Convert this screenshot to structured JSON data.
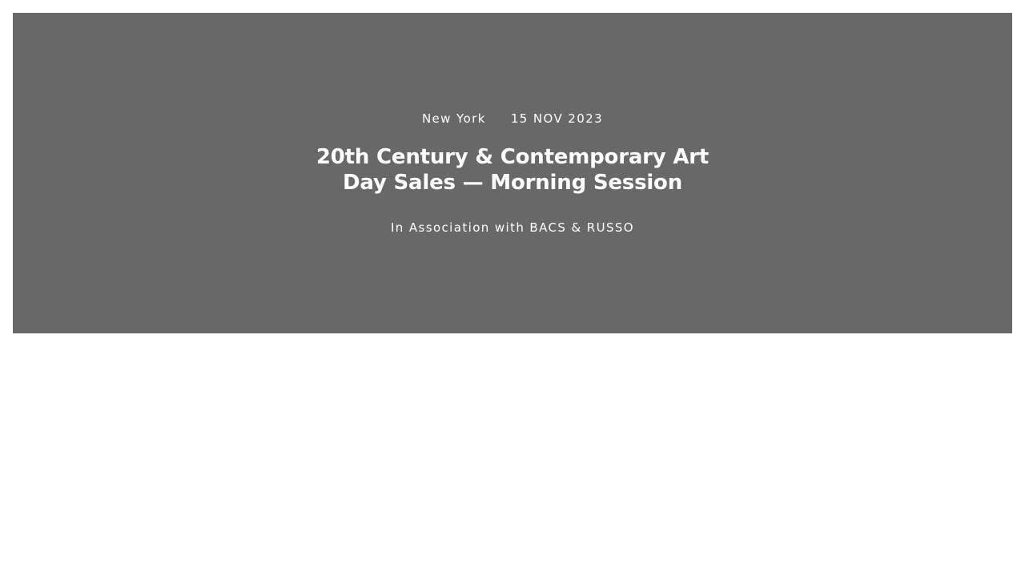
{
  "hero": {
    "location": "New York",
    "date": "15 NOV 2023",
    "title_line1": "20th Century & Contemporary Art",
    "title_line2": "Day Sales — Morning Session",
    "association": "In Association with BACS & RUSSO",
    "background_color": "#686868",
    "text_color": "#ffffff"
  }
}
